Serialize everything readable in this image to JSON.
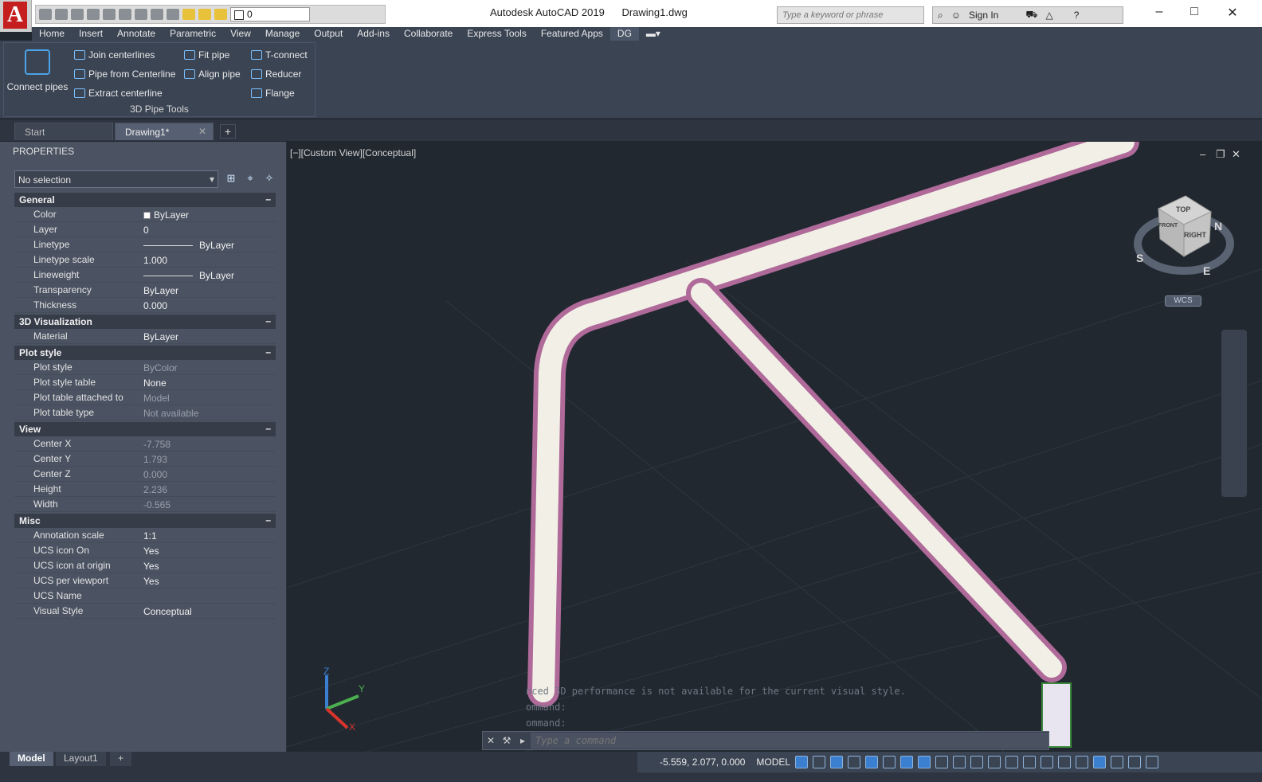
{
  "titlebar": {
    "app_name": "Autodesk AutoCAD 2019",
    "document": "Drawing1.dwg",
    "search_placeholder": "Type a keyword or phrase",
    "sign_in": "Sign In",
    "layer_value": "0"
  },
  "menu": [
    "Home",
    "Insert",
    "Annotate",
    "Parametric",
    "View",
    "Manage",
    "Output",
    "Add-ins",
    "Collaborate",
    "Express Tools",
    "Featured Apps",
    "DG"
  ],
  "ribbon": {
    "panel_title": "3D Pipe Tools",
    "big_button": "Connect pipes",
    "buttons": [
      "Join centerlines",
      "Pipe from Centerline",
      "Extract centerline",
      "Fit pipe",
      "Align pipe",
      "T-connect",
      "Reducer",
      "Flange"
    ]
  },
  "tabs": {
    "start": "Start",
    "drawing": "Drawing1*"
  },
  "properties": {
    "title": "PROPERTIES",
    "selection": "No selection",
    "sections": [
      {
        "name": "General",
        "rows": [
          {
            "k": "Color",
            "v": "ByLayer"
          },
          {
            "k": "Layer",
            "v": "0"
          },
          {
            "k": "Linetype",
            "v": "ByLayer"
          },
          {
            "k": "Linetype scale",
            "v": "1.000"
          },
          {
            "k": "Lineweight",
            "v": "ByLayer"
          },
          {
            "k": "Transparency",
            "v": "ByLayer"
          },
          {
            "k": "Thickness",
            "v": "0.000"
          }
        ]
      },
      {
        "name": "3D Visualization",
        "rows": [
          {
            "k": "Material",
            "v": "ByLayer"
          }
        ]
      },
      {
        "name": "Plot style",
        "rows": [
          {
            "k": "Plot style",
            "v": "ByColor"
          },
          {
            "k": "Plot style table",
            "v": "None"
          },
          {
            "k": "Plot table attached to",
            "v": "Model"
          },
          {
            "k": "Plot table type",
            "v": "Not available"
          }
        ]
      },
      {
        "name": "View",
        "rows": [
          {
            "k": "Center X",
            "v": "-7.758"
          },
          {
            "k": "Center Y",
            "v": "1.793"
          },
          {
            "k": "Center Z",
            "v": "0.000"
          },
          {
            "k": "Height",
            "v": "2.236"
          },
          {
            "k": "Width",
            "v": "-0.565"
          }
        ]
      },
      {
        "name": "Misc",
        "rows": [
          {
            "k": "Annotation scale",
            "v": "1:1"
          },
          {
            "k": "UCS icon On",
            "v": "Yes"
          },
          {
            "k": "UCS icon at origin",
            "v": "Yes"
          },
          {
            "k": "UCS per viewport",
            "v": "Yes"
          },
          {
            "k": "UCS Name",
            "v": ""
          },
          {
            "k": "Visual Style",
            "v": "Conceptual"
          }
        ]
      }
    ]
  },
  "viewport": {
    "label": "[−][Custom View][Conceptual]",
    "wcs": "WCS",
    "cube": {
      "top": "TOP",
      "right": "RIGHT",
      "front": "FRONT"
    },
    "compass": {
      "n": "N",
      "s": "S",
      "e": "E"
    },
    "ucs": {
      "x": "X",
      "y": "Y",
      "z": "Z"
    },
    "history": [
      "nced 3D performance is not available for the current visual style.",
      "ommand:",
      "ommand:"
    ],
    "command_placeholder": "Type a command"
  },
  "statusbar": {
    "layout_tabs": [
      "Model",
      "Layout1"
    ],
    "coords": "-5.559, 2.077, 0.000",
    "mode": "MODEL"
  }
}
